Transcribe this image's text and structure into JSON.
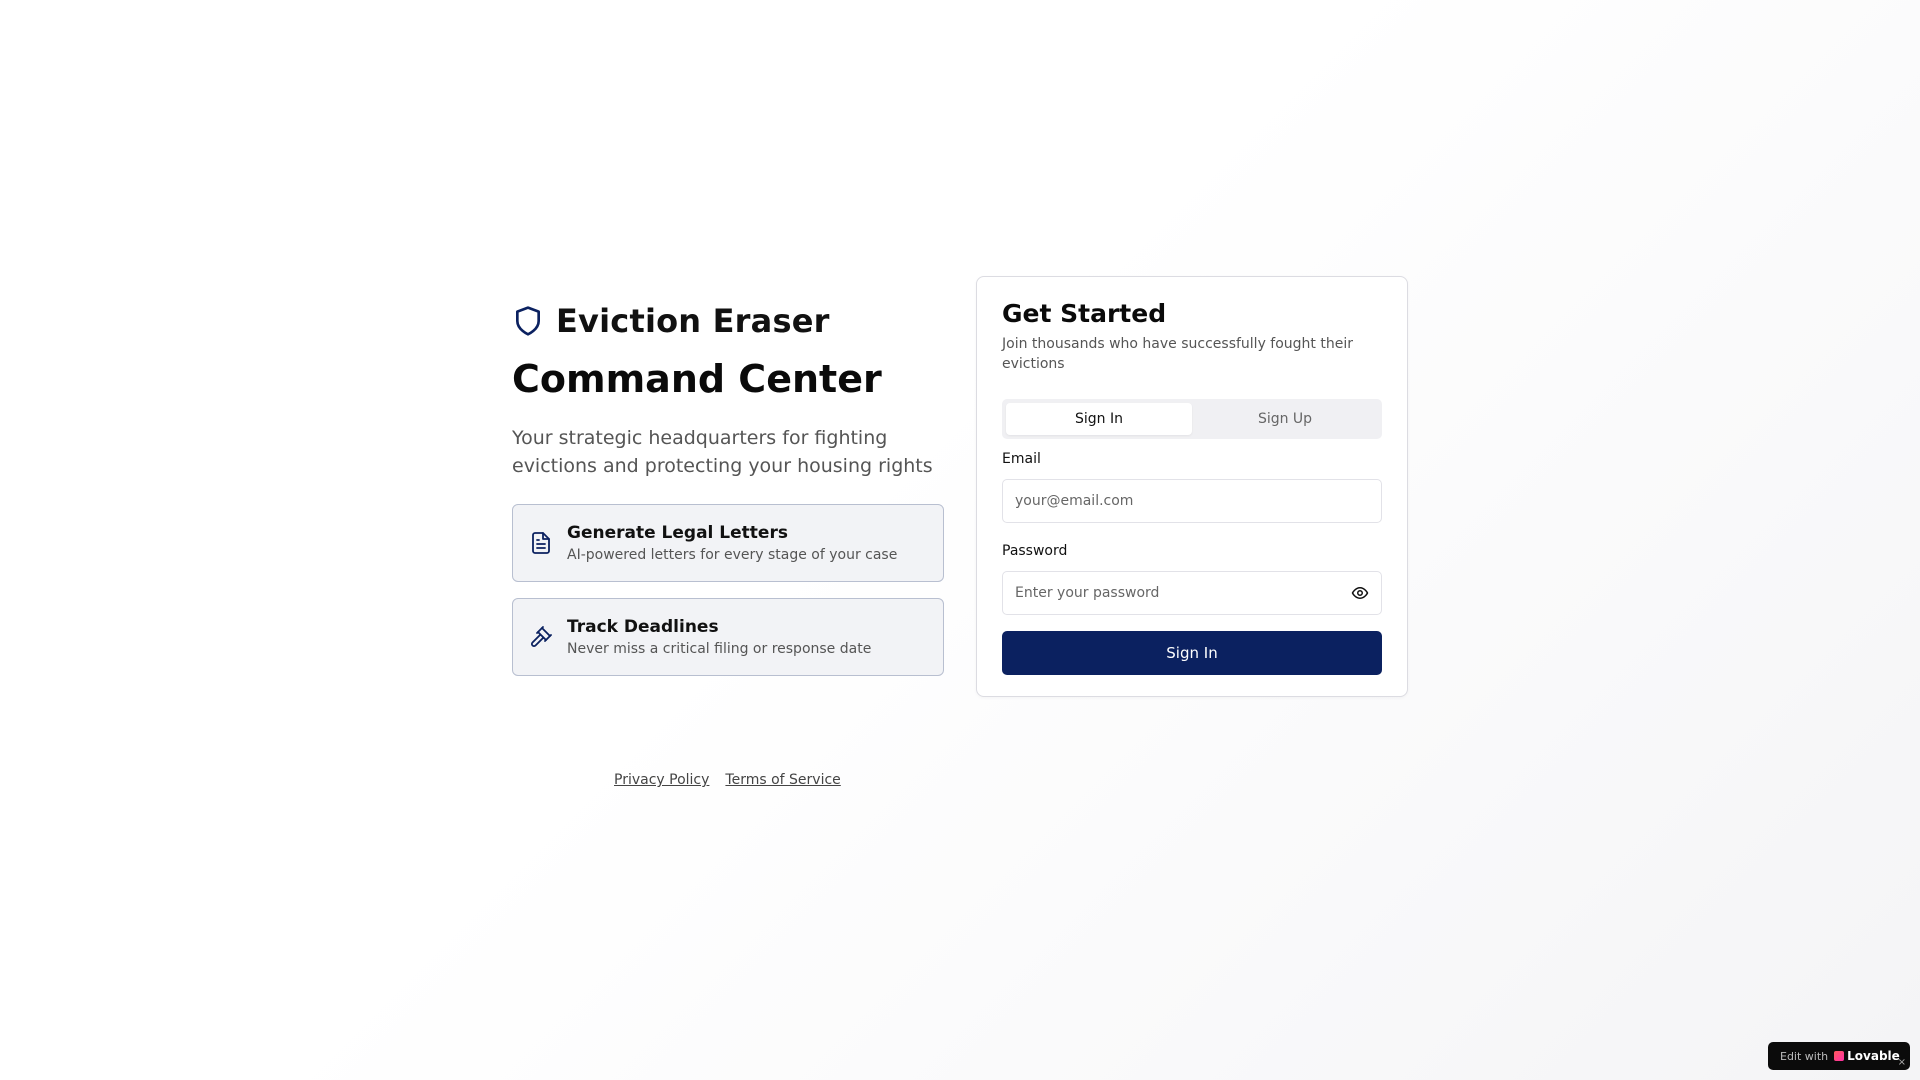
{
  "brand": {
    "name": "Eviction Eraser",
    "icon": "shield-icon"
  },
  "hero": {
    "headline": "Command Center",
    "tagline": "Your strategic headquarters for fighting evictions and protecting your housing rights"
  },
  "features": [
    {
      "icon": "document-icon",
      "title": "Generate Legal Letters",
      "description": "AI-powered letters for every stage of your case"
    },
    {
      "icon": "gavel-icon",
      "title": "Track Deadlines",
      "description": "Never miss a critical filing or response date"
    }
  ],
  "auth": {
    "title": "Get Started",
    "subtitle": "Join thousands who have successfully fought their evictions",
    "tabs": [
      {
        "label": "Sign In",
        "active": true
      },
      {
        "label": "Sign Up",
        "active": false
      }
    ],
    "email": {
      "label": "Email",
      "placeholder": "your@email.com",
      "value": ""
    },
    "password": {
      "label": "Password",
      "placeholder": "Enter your password",
      "value": ""
    },
    "submit_label": "Sign In"
  },
  "footer": {
    "privacy": "Privacy Policy",
    "terms": "Terms of Service"
  },
  "badge": {
    "prefix": "Edit with",
    "brand": "Lovable",
    "close": "×"
  },
  "colors": {
    "primary": "#0b2160",
    "feature_bg": "#f2f3f6",
    "feature_border": "#b8bfd0"
  }
}
